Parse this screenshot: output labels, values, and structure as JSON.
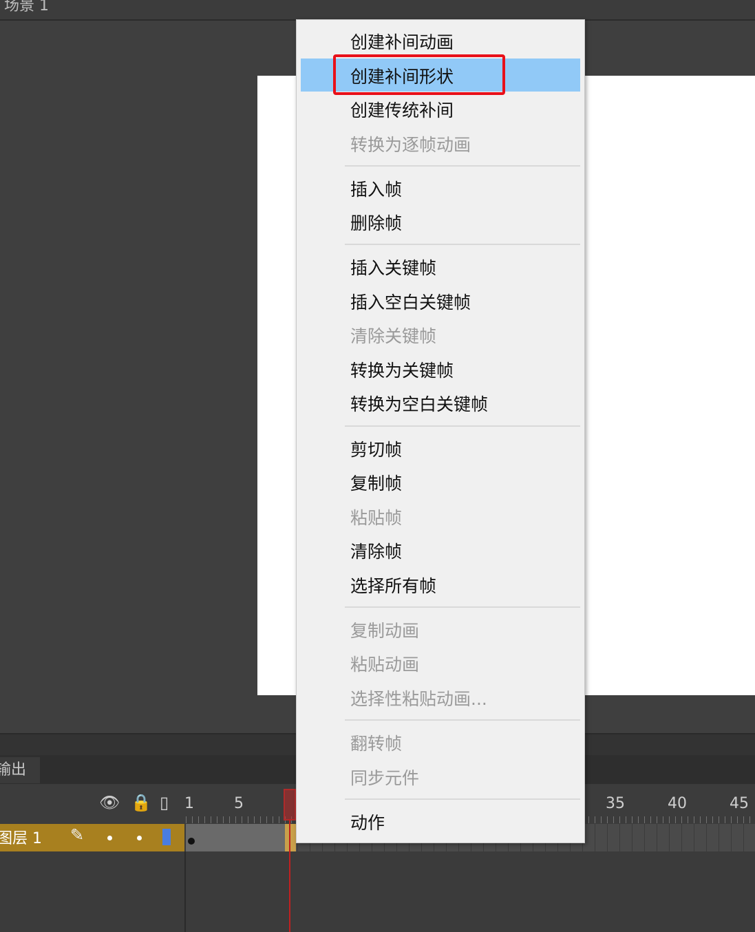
{
  "scene": {
    "title": "场景 1"
  },
  "panel": {
    "tab_output": "输出"
  },
  "timeline": {
    "frame_labels": [
      "1",
      "5",
      "35",
      "40",
      "45"
    ],
    "layer_name": "图层 1",
    "icons": {
      "eye": "eye-icon",
      "lock": "lock-icon",
      "outline": "outline-icon",
      "pencil": "pencil-icon"
    }
  },
  "context_menu": {
    "hovered_item": "创建补间形状",
    "items": [
      {
        "label": "创建补间动画",
        "enabled": true
      },
      {
        "label": "创建补间形状",
        "enabled": true
      },
      {
        "label": "创建传统补间",
        "enabled": true
      },
      {
        "label": "转换为逐帧动画",
        "enabled": false
      },
      {
        "label": "插入帧",
        "enabled": true
      },
      {
        "label": "删除帧",
        "enabled": true
      },
      {
        "label": "插入关键帧",
        "enabled": true
      },
      {
        "label": "插入空白关键帧",
        "enabled": true
      },
      {
        "label": "清除关键帧",
        "enabled": false
      },
      {
        "label": "转换为关键帧",
        "enabled": true
      },
      {
        "label": "转换为空白关键帧",
        "enabled": true
      },
      {
        "label": "剪切帧",
        "enabled": true
      },
      {
        "label": "复制帧",
        "enabled": true
      },
      {
        "label": "粘贴帧",
        "enabled": false
      },
      {
        "label": "清除帧",
        "enabled": true
      },
      {
        "label": "选择所有帧",
        "enabled": true
      },
      {
        "label": "复制动画",
        "enabled": false
      },
      {
        "label": "粘贴动画",
        "enabled": false
      },
      {
        "label": "选择性粘贴动画...",
        "enabled": false
      },
      {
        "label": "翻转帧",
        "enabled": false
      },
      {
        "label": "同步元件",
        "enabled": false
      },
      {
        "label": "动作",
        "enabled": true
      }
    ]
  },
  "colors": {
    "menu_hover": "#91c9f7",
    "highlight_box": "#e8101a",
    "layer_row": "#a8801f",
    "playhead": "#c02020"
  }
}
